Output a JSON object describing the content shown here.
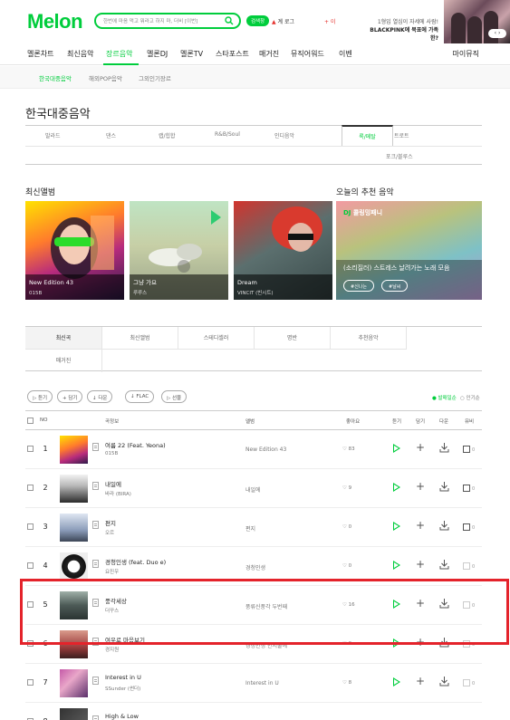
{
  "header": {
    "logo": "Melon",
    "search_text": "한번에 마음 먹고 뭐라고 하지 마, 더비 [이번]",
    "pill": "검색창",
    "user_mark": "▲",
    "user": "계 로그",
    "noti": "+ 이",
    "banner_line1": "1형입 열심이 자세에 사람!",
    "banner_line2": "BLACKPINK에 북표에 가족한?",
    "banner_nav": "‹ ›"
  },
  "gnb": {
    "items": [
      "멜론차트",
      "최신음악",
      "장르음악",
      "멜론DJ",
      "멜론TV",
      "스타포스트",
      "매거진",
      "뮤직어워드",
      "이벤"
    ],
    "active_index": 2,
    "mymusic": "마이뮤직"
  },
  "subnav": {
    "items": [
      "한국대중음악",
      "해외POP음악",
      "그외인기장르"
    ],
    "active_index": 0
  },
  "page_title": "한국대중음악",
  "genres": {
    "row1": [
      "발라드",
      "댄스",
      "랩/힙합",
      "R&B/Soul",
      "인디음악",
      "록/메탈",
      "트로트"
    ],
    "row2": [
      "포크/블루스"
    ],
    "active": "록/메탈"
  },
  "sections": {
    "new_albums": "최신앨범",
    "recommend": "오늘의 추천 음악"
  },
  "albums": [
    {
      "title": "New Edition 43",
      "artist": "015B"
    },
    {
      "title": "그냥 가요",
      "artist": "루루스"
    },
    {
      "title": "Dream",
      "artist": "VINCIT (빈시트)"
    }
  ],
  "recommend": {
    "dj_label": "DJ",
    "dj_name": "콜링밍패니",
    "desc": "(소리질러) 스트레스 날려가는 노래 모음",
    "tags": [
      "#신나는",
      "#날씨"
    ]
  },
  "tabs": {
    "row1": [
      "최신곡",
      "최신앨범",
      "스테디셀러",
      "명반",
      "추천음악"
    ],
    "row2": [
      "매거진"
    ],
    "active": "최신곡"
  },
  "actions": {
    "buttons": [
      "▷ 듣기",
      "+ 담기",
      "↓ 다운",
      "↓ FLAC",
      "▷ 선물"
    ],
    "sort_new": "● 발매일순",
    "sort_pop": "○ 인기순"
  },
  "table_header": {
    "no": "NO",
    "song": "곡정보",
    "album": "앨범",
    "like": "좋아요",
    "listen": "듣기",
    "add": "담기",
    "download": "다운",
    "mv": "뮤비"
  },
  "songs": [
    {
      "no": "1",
      "title": "여름 22 (Feat. Yeona)",
      "artist": "015B",
      "album": "New Edition 43",
      "likes": "♡ 83",
      "mv": "0"
    },
    {
      "no": "2",
      "title": "내일에",
      "artist": "바라 (BIRA)",
      "album": "내일에",
      "likes": "♡ 9",
      "mv": "0"
    },
    {
      "no": "3",
      "title": "편지",
      "artist": "오르",
      "album": "편지",
      "likes": "♡ 0",
      "mv": "0"
    },
    {
      "no": "4",
      "title": "경청인생 (feat. Duo e)",
      "artist": "요진우",
      "album": "경청인생",
      "likes": "♡ 0",
      "mv": "0"
    },
    {
      "no": "5",
      "title": "풍각세상",
      "artist": "더꾸스",
      "album": "풍류신풍각 두번째",
      "likes": "♡ 16",
      "mv": "0"
    },
    {
      "no": "6",
      "title": "여우로 마음보기",
      "artist": "경지원",
      "album": "경청인생 인서울에",
      "likes": "♡ 0",
      "mv": "0"
    },
    {
      "no": "7",
      "title": "Interest in U",
      "artist": "SSunder (썬더)",
      "album": "Interest in U",
      "likes": "♡ 8",
      "mv": "0"
    },
    {
      "no": "8",
      "title": "High & Low",
      "artist": "",
      "album": "",
      "likes": "",
      "mv": ""
    }
  ],
  "colors": {
    "brand": "#00cd3c",
    "highlight": "#e4232b"
  }
}
